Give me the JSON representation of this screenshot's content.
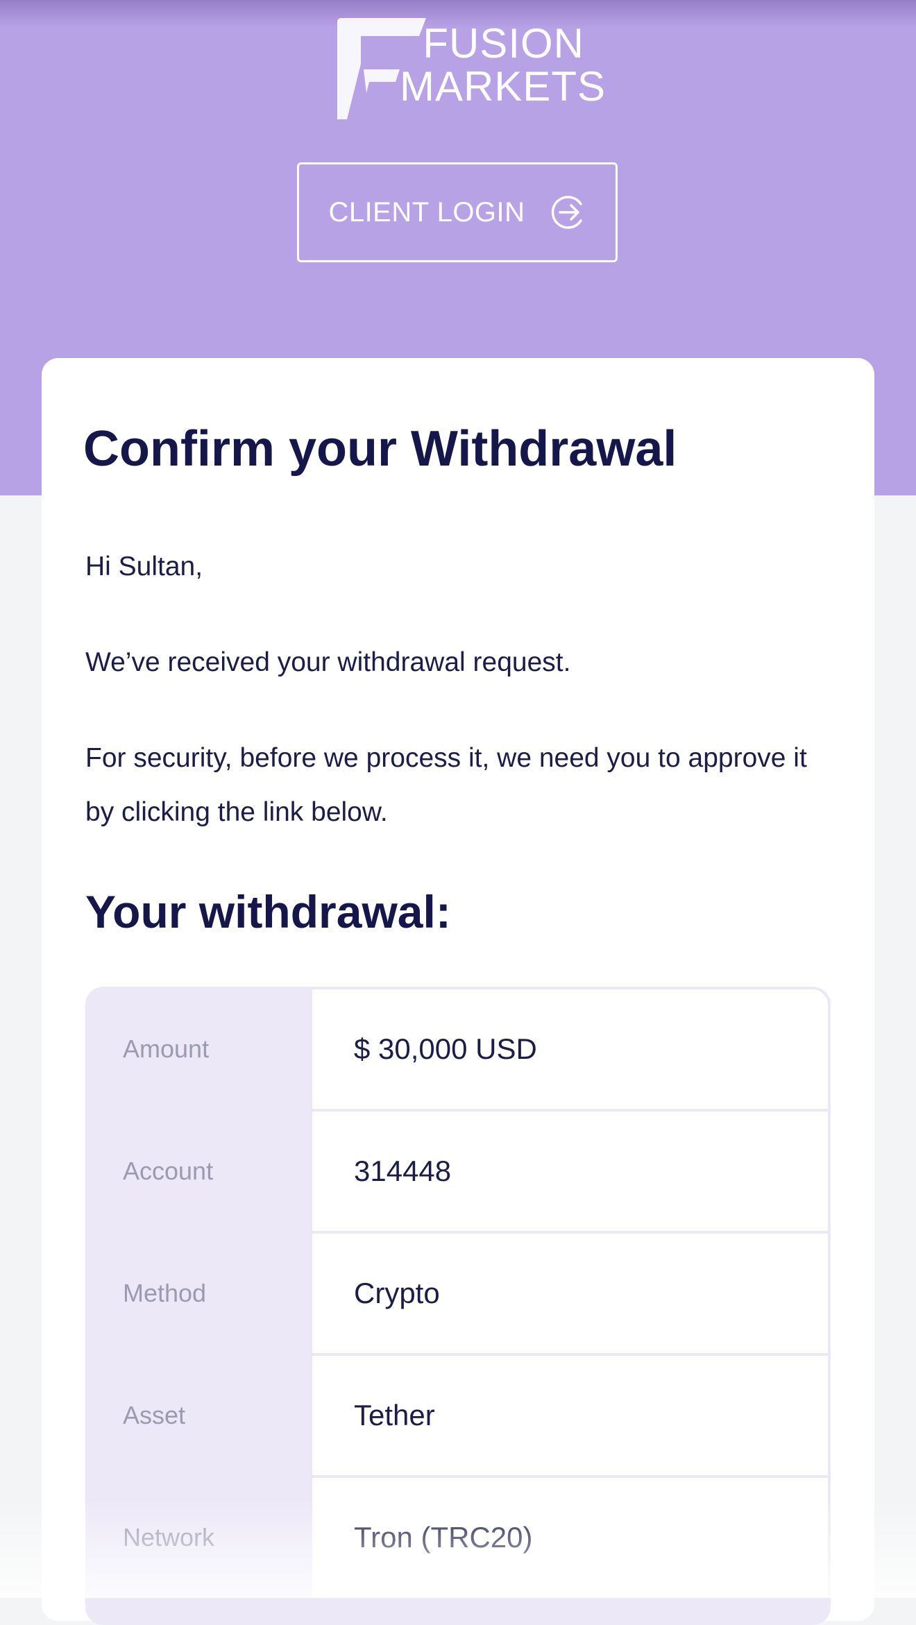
{
  "brand": {
    "logo_line1": "FUSION",
    "logo_line2": "MARKETS",
    "logo_icon": "fusion-f-logo-icon",
    "header_color": "#b8a2e6"
  },
  "header": {
    "login_label": "CLIENT LOGIN",
    "login_icon": "arrow-circle-right-icon"
  },
  "email": {
    "title": "Confirm your Withdrawal",
    "greeting": "Hi Sultan,",
    "body1": "We’ve received your withdrawal request.",
    "body2": "For security, before we process it, we need you to approve it by clicking the link below.",
    "subhead": "Your withdrawal:"
  },
  "withdrawal": {
    "rows": [
      {
        "label": "Amount",
        "value": "$ 30,000 USD"
      },
      {
        "label": "Account",
        "value": "314448"
      },
      {
        "label": "Method",
        "value": "Crypto"
      },
      {
        "label": "Asset",
        "value": "Tether"
      },
      {
        "label": "Network",
        "value": "Tron (TRC20)"
      }
    ]
  },
  "colors": {
    "accent": "#b8a2e6",
    "text_dark": "#15174a",
    "label_bg": "#ece8f8"
  }
}
